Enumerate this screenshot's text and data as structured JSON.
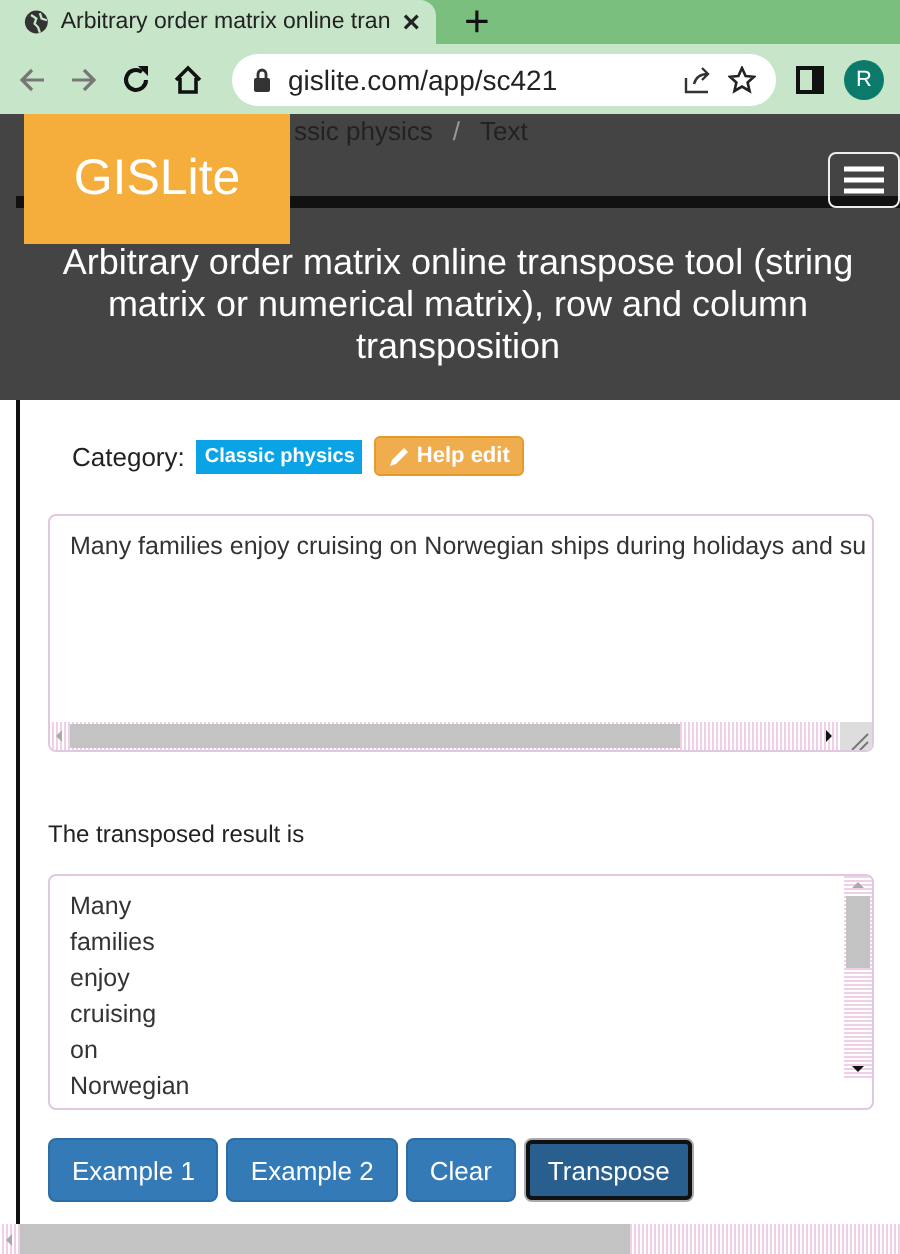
{
  "browser": {
    "tab_title": "Arbitrary order matrix online tran",
    "close": "×",
    "new_tab": "+",
    "url": "gislite.com/app/sc421",
    "avatar": "R"
  },
  "breadcrumb": [
    "ssic physics",
    "Text"
  ],
  "breadcrumb_separator": "/",
  "logo": "GISLite",
  "title": "Arbitrary order matrix online transpose tool (string matrix or numerical matrix), row and column transposition",
  "category": {
    "label": "Category:",
    "badge": "Classic physics",
    "help": "Help edit"
  },
  "input": {
    "value": "Many families enjoy cruising on Norwegian ships during holidays and su"
  },
  "result_label": "The transposed result is",
  "result_lines": [
    "Many",
    "families",
    "enjoy",
    "cruising",
    "on",
    "Norwegian"
  ],
  "buttons": [
    {
      "label": "Example 1",
      "focused": false
    },
    {
      "label": "Example 2",
      "focused": false
    },
    {
      "label": "Clear",
      "focused": false
    },
    {
      "label": "Transpose",
      "focused": true
    }
  ]
}
